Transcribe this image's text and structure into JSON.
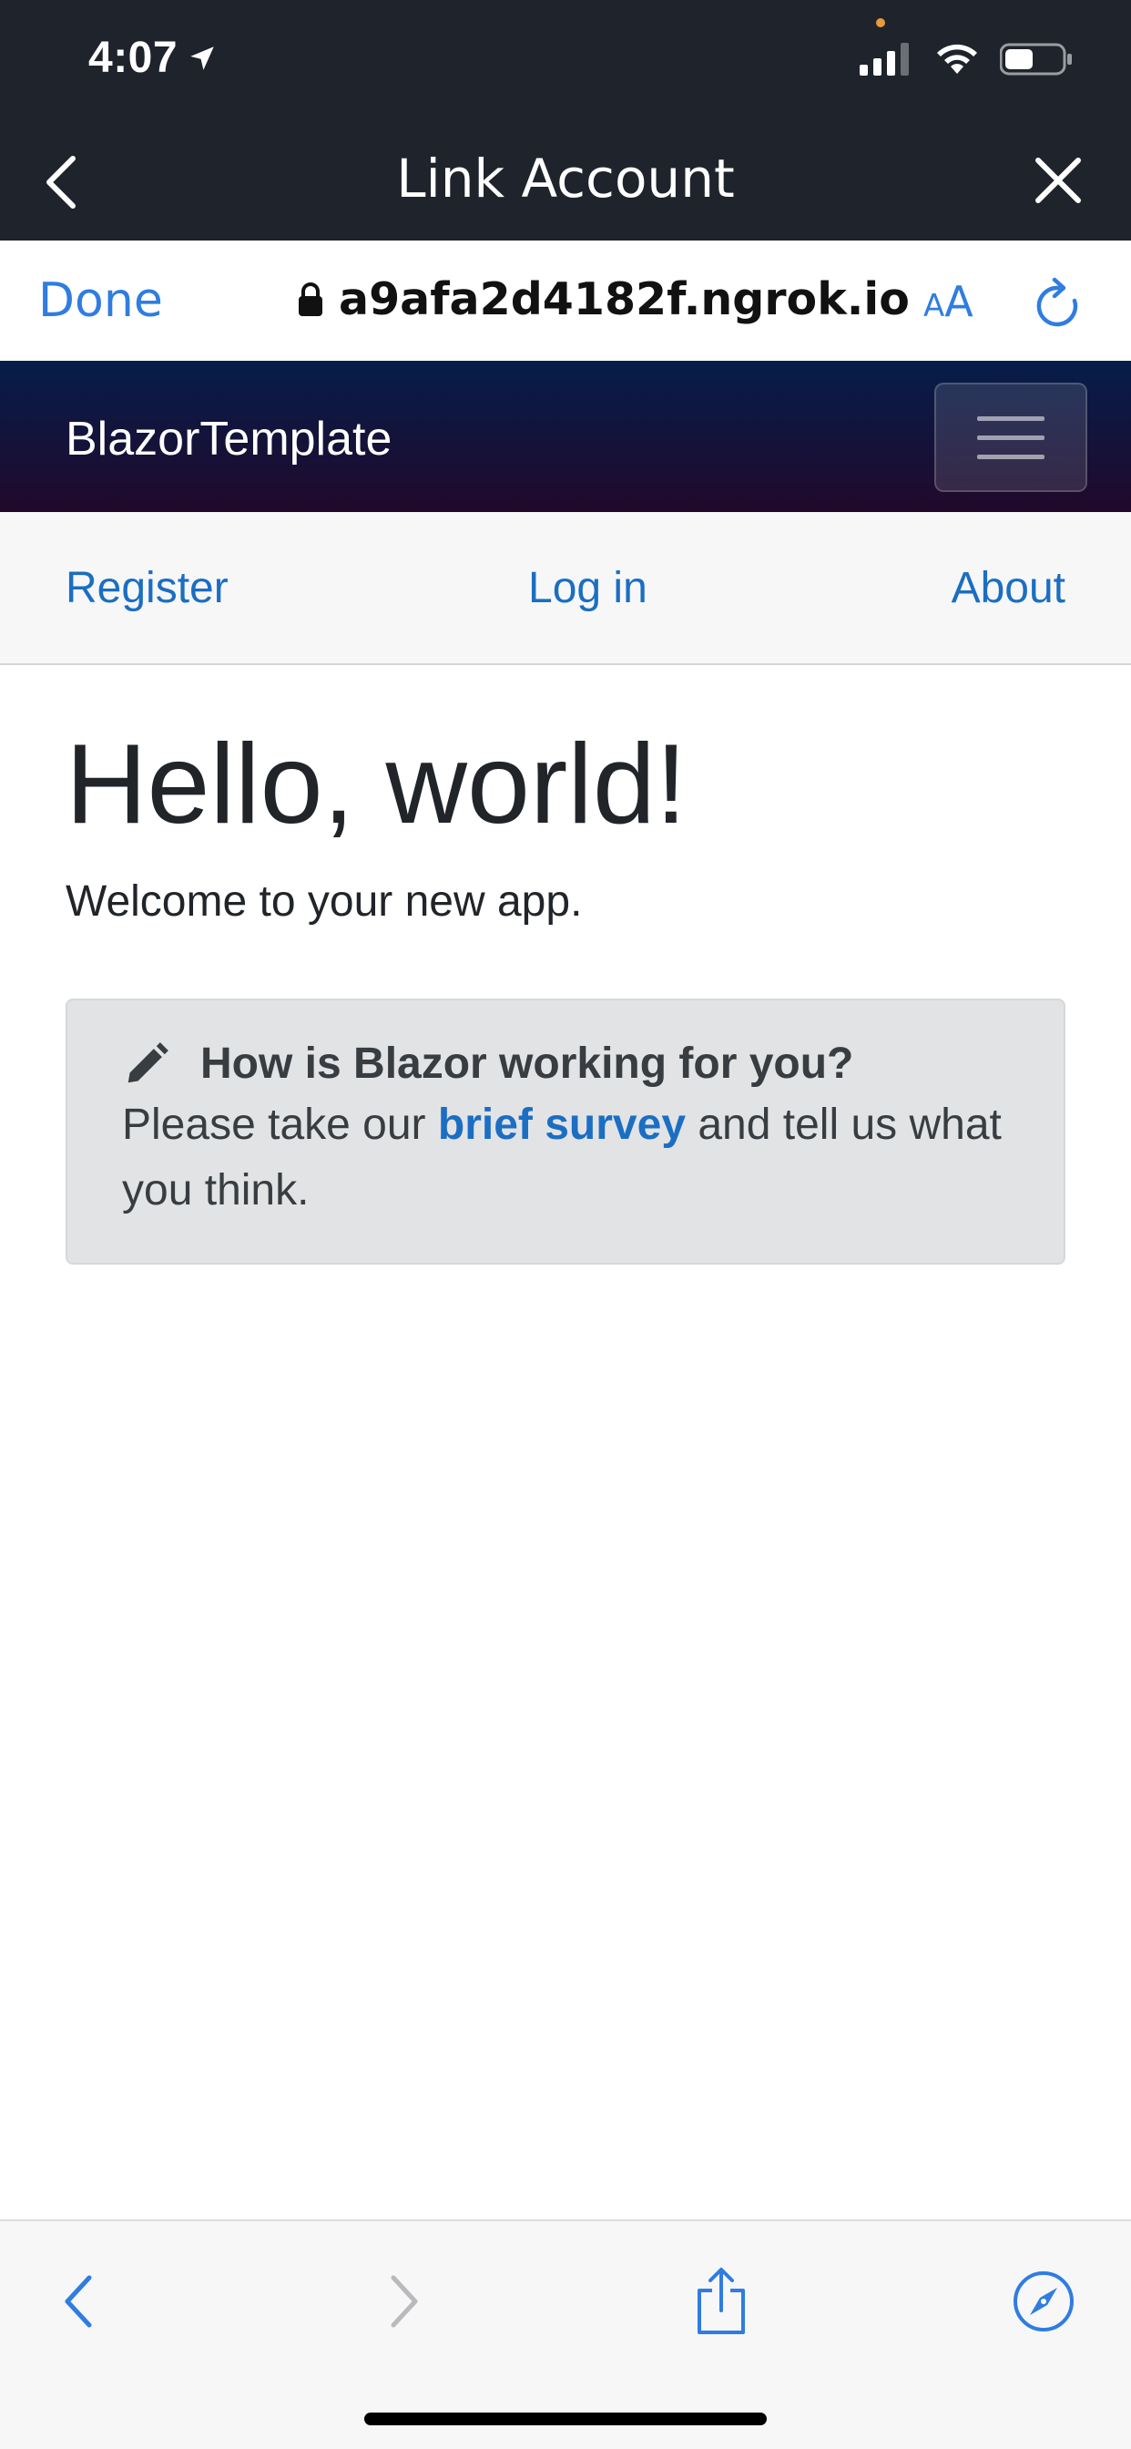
{
  "status_bar": {
    "time": "4:07",
    "icons": [
      "location-arrow-icon",
      "signal-icon",
      "wifi-icon",
      "battery-icon"
    ]
  },
  "modal_header": {
    "title": "Link Account",
    "icons": [
      "chevron-left-icon",
      "close-icon"
    ]
  },
  "browser": {
    "done_label": "Done",
    "url": "a9afa2d4182f.ngrok.io",
    "text_size_small": "A",
    "text_size_big": "A",
    "icons": [
      "lock-icon",
      "reload-icon"
    ]
  },
  "app_navbar": {
    "brand": "BlazorTemplate",
    "toggler_icon": "hamburger-icon"
  },
  "top_row": {
    "register": "Register",
    "login": "Log in",
    "about": "About"
  },
  "content": {
    "title": "Hello, world!",
    "subtitle": "Welcome to your new app.",
    "survey": {
      "icon": "pencil-icon",
      "title": "How is Blazor working for you?",
      "text_before": "Please take our ",
      "link": "brief survey",
      "text_after": " and tell us what you think."
    }
  },
  "bottom_toolbar": {
    "icons": [
      "back-icon",
      "forward-icon",
      "share-icon",
      "safari-compass-icon"
    ]
  },
  "colors": {
    "accent": "#2f7de0",
    "link": "#1b6ec2",
    "header_dark": "#1f232b",
    "navbar_top": "#061d4a",
    "navbar_bottom": "#21092b",
    "alert_bg": "#e2e3e5"
  }
}
